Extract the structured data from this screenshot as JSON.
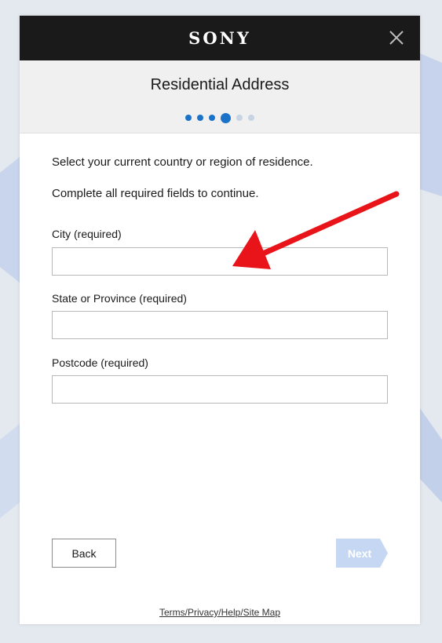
{
  "brand": {
    "logo_text": "SONY"
  },
  "header": {
    "title": "Residential Address"
  },
  "progress": {
    "total_steps": 6,
    "current_step": 4
  },
  "instructions": [
    "Select your current country or region of residence.",
    "Complete all required fields to continue."
  ],
  "fields": [
    {
      "label": "City (required)",
      "value": ""
    },
    {
      "label": "State or Province (required)",
      "value": ""
    },
    {
      "label": "Postcode (required)",
      "value": ""
    }
  ],
  "buttons": {
    "back_label": "Back",
    "next_label": "Next"
  },
  "footer": {
    "links_text": "Terms/Privacy/Help/Site Map"
  },
  "colors": {
    "topbar": "#1a1a1a",
    "accent_blue": "#1a73c9",
    "next_disabled": "#c5d7f2",
    "annotation_arrow": "#e8141a"
  },
  "icons": {
    "close": "close-icon",
    "annotation": "red-arrow-annotation"
  }
}
